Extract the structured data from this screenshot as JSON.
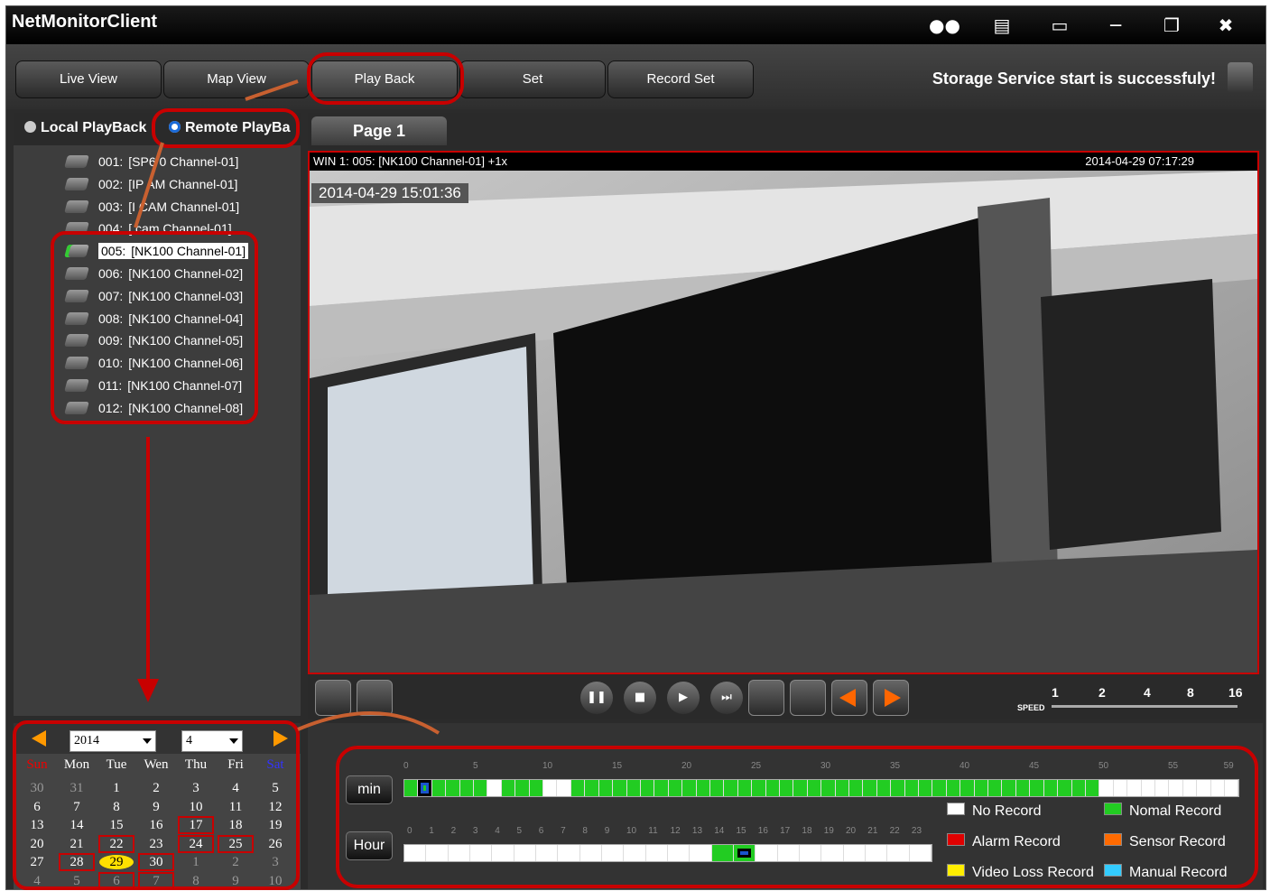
{
  "app": {
    "title": "NetMonitorClient",
    "status": "Storage Service start is successfuly!"
  },
  "tabs": [
    {
      "label": "Live View"
    },
    {
      "label": "Map View"
    },
    {
      "label": "Play Back"
    },
    {
      "label": "Set"
    },
    {
      "label": "Record Set"
    }
  ],
  "playback_mode": {
    "local": "Local PlayBack",
    "remote": "Remote PlayBa"
  },
  "channels": [
    {
      "num": "001:",
      "name": "[SP6 0 Channel-01]"
    },
    {
      "num": "002:",
      "name": "[IP AM Channel-01]"
    },
    {
      "num": "003:",
      "name": "[I CAM Channel-01]"
    },
    {
      "num": "004:",
      "name": "[ cam Channel-01]"
    },
    {
      "num": "005:",
      "name": "[NK100 Channel-01]"
    },
    {
      "num": "006:",
      "name": "[NK100 Channel-02]"
    },
    {
      "num": "007:",
      "name": "[NK100 Channel-03]"
    },
    {
      "num": "008:",
      "name": "[NK100 Channel-04]"
    },
    {
      "num": "009:",
      "name": "[NK100 Channel-05]"
    },
    {
      "num": "010:",
      "name": "[NK100 Channel-06]"
    },
    {
      "num": "011:",
      "name": "[NK100 Channel-07]"
    },
    {
      "num": "012:",
      "name": "[NK100 Channel-08]"
    }
  ],
  "calendar": {
    "year": "2014",
    "month": "4",
    "weekdays": [
      "Sun",
      "Mon",
      "Tue",
      "Wen",
      "Thu",
      "Fri",
      "Sat"
    ],
    "weeks": [
      [
        "30",
        "31",
        "1",
        "2",
        "3",
        "4",
        "5"
      ],
      [
        "6",
        "7",
        "8",
        "9",
        "10",
        "11",
        "12"
      ],
      [
        "13",
        "14",
        "15",
        "16",
        "17",
        "18",
        "19"
      ],
      [
        "20",
        "21",
        "22",
        "23",
        "24",
        "25",
        "26"
      ],
      [
        "27",
        "28",
        "29",
        "30",
        "1",
        "2",
        "3"
      ],
      [
        "4",
        "5",
        "6",
        "7",
        "8",
        "9",
        "10"
      ]
    ]
  },
  "page": {
    "label": "Page 1"
  },
  "video": {
    "header": "WIN 1: 005: [NK100 Channel-01] +1x",
    "header_time": "2014-04-29 07:17:29",
    "overlay_time": "2014-04-29 15:01:36"
  },
  "speed": {
    "label": "SPEED",
    "values": [
      "1",
      "2",
      "4",
      "8",
      "16"
    ]
  },
  "timeline": {
    "min_label": "min",
    "hour_label": "Hour",
    "min_ticks": [
      "0",
      "5",
      "10",
      "15",
      "20",
      "25",
      "30",
      "35",
      "40",
      "45",
      "50",
      "55",
      "59"
    ],
    "hour_ticks": [
      "0",
      "1",
      "2",
      "3",
      "4",
      "5",
      "6",
      "7",
      "8",
      "9",
      "10",
      "11",
      "12",
      "13",
      "14",
      "15",
      "16",
      "17",
      "18",
      "19",
      "20",
      "21",
      "22",
      "23"
    ]
  },
  "legend": [
    {
      "label": "No Record",
      "color": "#ffffff"
    },
    {
      "label": "Nomal Record",
      "color": "#22cc22"
    },
    {
      "label": "Alarm Record",
      "color": "#e00000"
    },
    {
      "label": "Sensor Record",
      "color": "#ff6a00"
    },
    {
      "label": "Video Loss Record",
      "color": "#ffee00"
    },
    {
      "label": "Manual Record",
      "color": "#33ccff"
    }
  ]
}
